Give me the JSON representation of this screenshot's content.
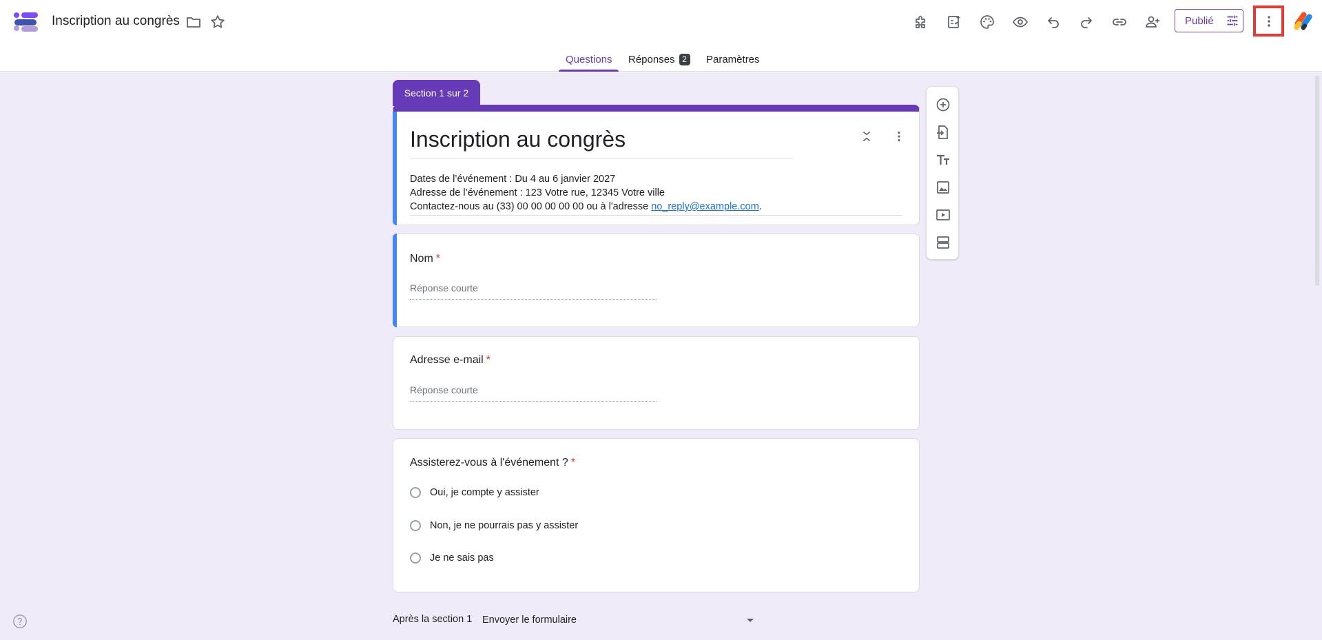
{
  "app": {
    "doc_title": "Inscription au congrès",
    "icons": [
      "forms-logo",
      "folder-icon",
      "star-icon"
    ]
  },
  "toolbar": {
    "icons": [
      "addons-icon",
      "quiz-icon",
      "palette-icon",
      "preview-eye-icon",
      "undo-icon",
      "redo-icon",
      "link-icon",
      "add-collaborator-icon",
      "more-vert-icon"
    ],
    "publish_label": "Publié"
  },
  "tabs": [
    {
      "label": "Questions",
      "active": true
    },
    {
      "label": "Réponses",
      "badge": "2"
    },
    {
      "label": "Paramètres"
    }
  ],
  "section_label": "Section 1 sur 2",
  "form": {
    "title": "Inscription au congrès",
    "description_lines": [
      "Dates de l’événement : Du 4 au 6 janvier 2027",
      "Adresse de l’événement : 123 Votre rue, 12345 Votre ville"
    ],
    "contact_prefix": "Contactez-nous au (33) 00 00 00 00 00 ou à l'adresse ",
    "contact_email": "no_reply@example.com",
    "contact_suffix": "."
  },
  "questions": [
    {
      "title": "Nom",
      "required_mark": "*",
      "placeholder": "Réponse courte"
    },
    {
      "title": "Adresse e-mail",
      "required_mark": "*",
      "placeholder": "Réponse courte"
    },
    {
      "title": "Assisterez-vous à l'événement ?",
      "required_mark": "*",
      "options": [
        "Oui, je compte y assister",
        "Non, je ne pourrais pas y assister",
        "Je ne sais pas"
      ]
    }
  ],
  "side_toolbar": {
    "icons": [
      "add-question-icon",
      "import-questions-icon",
      "add-title-icon",
      "add-image-icon",
      "add-video-icon",
      "add-section-icon"
    ]
  },
  "after_section": {
    "label": "Après la section 1",
    "value": "Envoyer le formulaire"
  },
  "colors": {
    "accent": "#673ab7",
    "canvas_bg": "#f0ebf8",
    "focus_bar": "#4285f4",
    "required": "#d93025",
    "link": "#1a73e8",
    "highlight_box": "#e53935"
  }
}
